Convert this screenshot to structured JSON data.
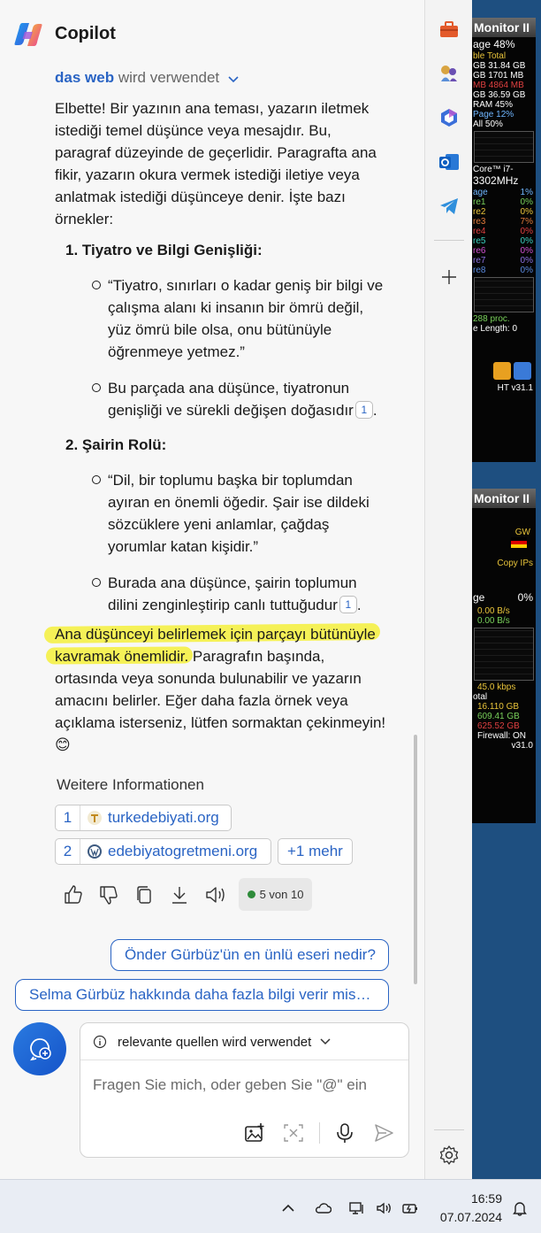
{
  "app": {
    "title": "Copilot"
  },
  "source_line": {
    "web": "das web",
    "rest": "wird verwendet"
  },
  "response": {
    "intro": "Elbette! Bir yazının ana teması, yazarın iletmek istediği temel düşünce veya mesajdır. Bu, paragraf düzeyinde de geçerlidir. Paragrafta ana fikir, yazarın okura vermek istediği iletiye veya anlatmak istediği düşünceye denir. İşte bazı örnekler:",
    "items": [
      {
        "num": "1.",
        "title": "Tiyatro ve Bilgi Genişliği:",
        "bullets": [
          {
            "text": "“Tiyatro, sınırları o kadar geniş bir bilgi ve çalışma alanı ki insanın bir ömrü değil, yüz ömrü bile olsa, onu bütünüyle öğrenmeye yetmez.”"
          },
          {
            "text": "Bu parçada ana düşünce, tiyatronun genişliği ve sürekli değişen doğasıdır",
            "cite": "1",
            "after": "."
          }
        ]
      },
      {
        "num": "2.",
        "title": "Şairin Rolü:",
        "bullets": [
          {
            "text": "“Dil, bir toplumu başka bir toplumdan ayıran en önemli öğedir. Şair ise dildeki sözcüklere yeni anlamlar, çağdaş yorumlar katan kişidir.”"
          },
          {
            "text": "Burada ana düşünce, şairin toplumun dilini zenginleştirip canlı tuttuğudur",
            "cite": "1",
            "after": "."
          }
        ]
      }
    ],
    "closing": "Ana düşünceyi belirlemek için parçayı bütünüyle kavramak önemlidir. Paragrafın başında, ortasında veya sonunda bulunabilir ve yazarın amacını belirler. Eğer daha fazla örnek veya açıklama isterseniz, lütfen sormaktan çekinmeyin! 😊"
  },
  "more_info": {
    "title": "Weitere Informationen",
    "sources": [
      {
        "n": "1",
        "label": "turkedebiyati.org"
      },
      {
        "n": "2",
        "label": "edebiyatogretmeni.org"
      }
    ],
    "more": "+1 mehr"
  },
  "actions": {
    "pager": "5 von 10"
  },
  "suggestions": [
    "Önder Gürbüz'ün en ünlü eseri nedir?",
    "Selma Gürbüz hakkında daha fazla bilgi verir mis…"
  ],
  "composer": {
    "source_mode": "relevante quellen wird verwendet",
    "placeholder": "Fragen Sie mich, oder geben Sie \"@\" ein"
  },
  "widgets": {
    "cpu": {
      "title": "Monitor II",
      "rows": [
        "age   48%",
        "ble   Total",
        "GB  31.84 GB",
        "GB   1701 MB",
        "MB   4864 MB",
        "GB  36.59 GB",
        "RAM   45%",
        "Page   12%",
        "All   50%"
      ],
      "cpu_name": "Core™ i7-",
      "cpu_mhz": "3302MHz",
      "usage_label": "age",
      "usage": "1%",
      "cores": [
        [
          "re1",
          "0%"
        ],
        [
          "re2",
          "0%"
        ],
        [
          "re3",
          "7%"
        ],
        [
          "re4",
          "0%"
        ],
        [
          "re5",
          "0%"
        ],
        [
          "re6",
          "0%"
        ],
        [
          "re7",
          "0%"
        ],
        [
          "re8",
          "0%"
        ]
      ],
      "proc": "288 proc.",
      "queue": "e Length: 0",
      "footer": "HT  v31.1"
    },
    "net": {
      "title": "Monitor II",
      "gw": "GW",
      "copy_ips": "Copy IPs",
      "usage_label": "ge",
      "usage": "0%",
      "rate1": "0.00 B/s",
      "rate2": "0.00 B/s",
      "speed": "45.0 kbps",
      "total_label": "otal",
      "dl": "16.110 GB",
      "ul": "609.41 GB",
      "sum": "625.52 GB",
      "firewall": "Firewall: ON",
      "footer": "v31.0"
    }
  },
  "taskbar": {
    "time": "16:59",
    "date": "07.07.2024"
  },
  "colors": {
    "accent": "#2a64c4",
    "highlight": "#f4f04e",
    "panel": "#f7f7f7"
  }
}
